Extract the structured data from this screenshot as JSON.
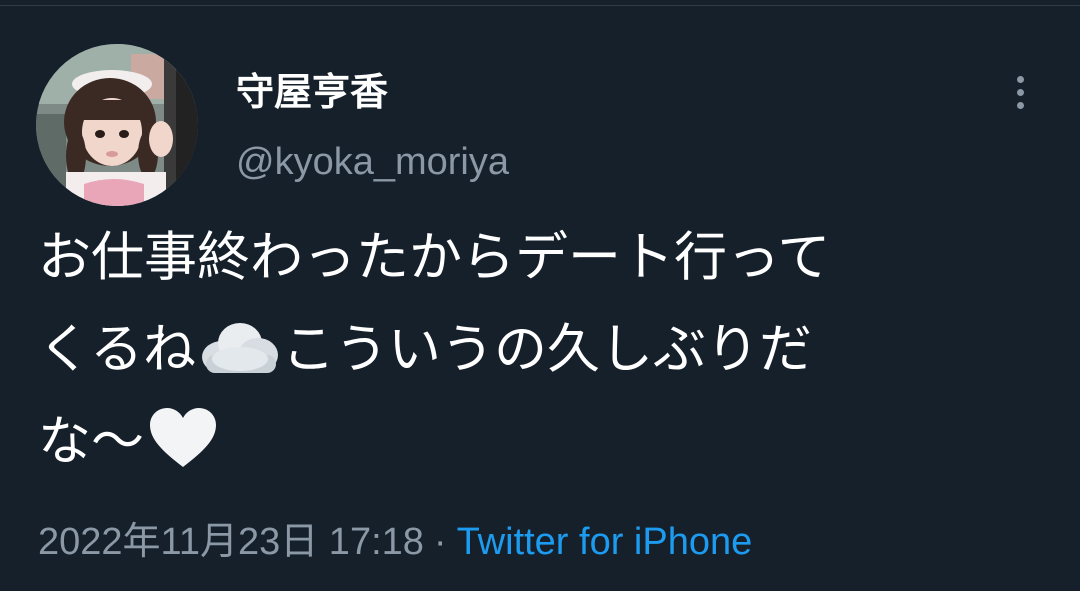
{
  "author": {
    "display_name": "守屋亨香",
    "handle": "@kyoka_moriya"
  },
  "tweet": {
    "line1": "お仕事終わったからデート行って",
    "line2_a": "くるね",
    "line2_emoji": "cloud-emoji",
    "line2_b": "こういうの久しぶりだ",
    "line3_a": "な〜",
    "line3_emoji": "white-heart-emoji"
  },
  "meta": {
    "timestamp": "2022年11月23日 17:18",
    "separator": "·",
    "source": "Twitter for iPhone"
  },
  "colors": {
    "background": "#15202b",
    "text": "#ffffff",
    "secondary": "#8b98a5",
    "link": "#1d9bf0"
  }
}
